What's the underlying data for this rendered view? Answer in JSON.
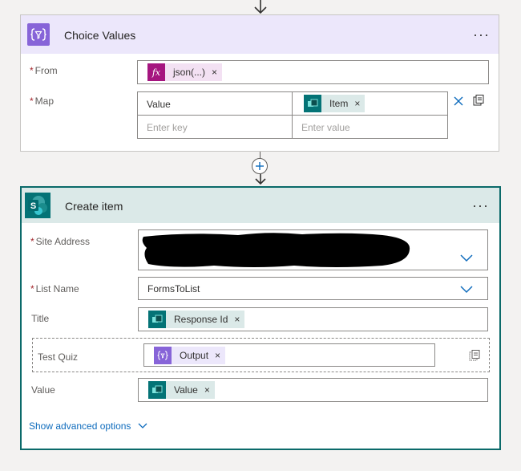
{
  "connector_arrow_top": "down-arrow-icon",
  "choice_values": {
    "title": "Choice Values",
    "more_label": "···",
    "from": {
      "label": "From",
      "required_mark": "*",
      "token": {
        "label": "json(...)",
        "icon": "fx-icon",
        "color": "#f3e1f3",
        "icon_color": "#a5157f"
      }
    },
    "map": {
      "label": "Map",
      "required_mark": "*",
      "key_value": "Value",
      "value_token": {
        "label": "Item",
        "icon": "sharepoint-data-icon"
      },
      "key_placeholder": "Enter key",
      "value_placeholder": "Enter value"
    },
    "accent_color": "#8764d8"
  },
  "add_step_icon": "plus-circle-icon",
  "create_item": {
    "title": "Create item",
    "more_label": "···",
    "site_address": {
      "label": "Site Address",
      "required_mark": "*"
    },
    "list_name": {
      "label": "List Name",
      "required_mark": "*",
      "value": "FormsToList"
    },
    "title_field": {
      "label": "Title",
      "token": "Response Id"
    },
    "test_quiz": {
      "label": "Test Quiz",
      "token": "Output"
    },
    "value_field": {
      "label": "Value",
      "token": "Value"
    },
    "advanced_link": "Show advanced options",
    "accent_color": "#0b6a6a"
  }
}
